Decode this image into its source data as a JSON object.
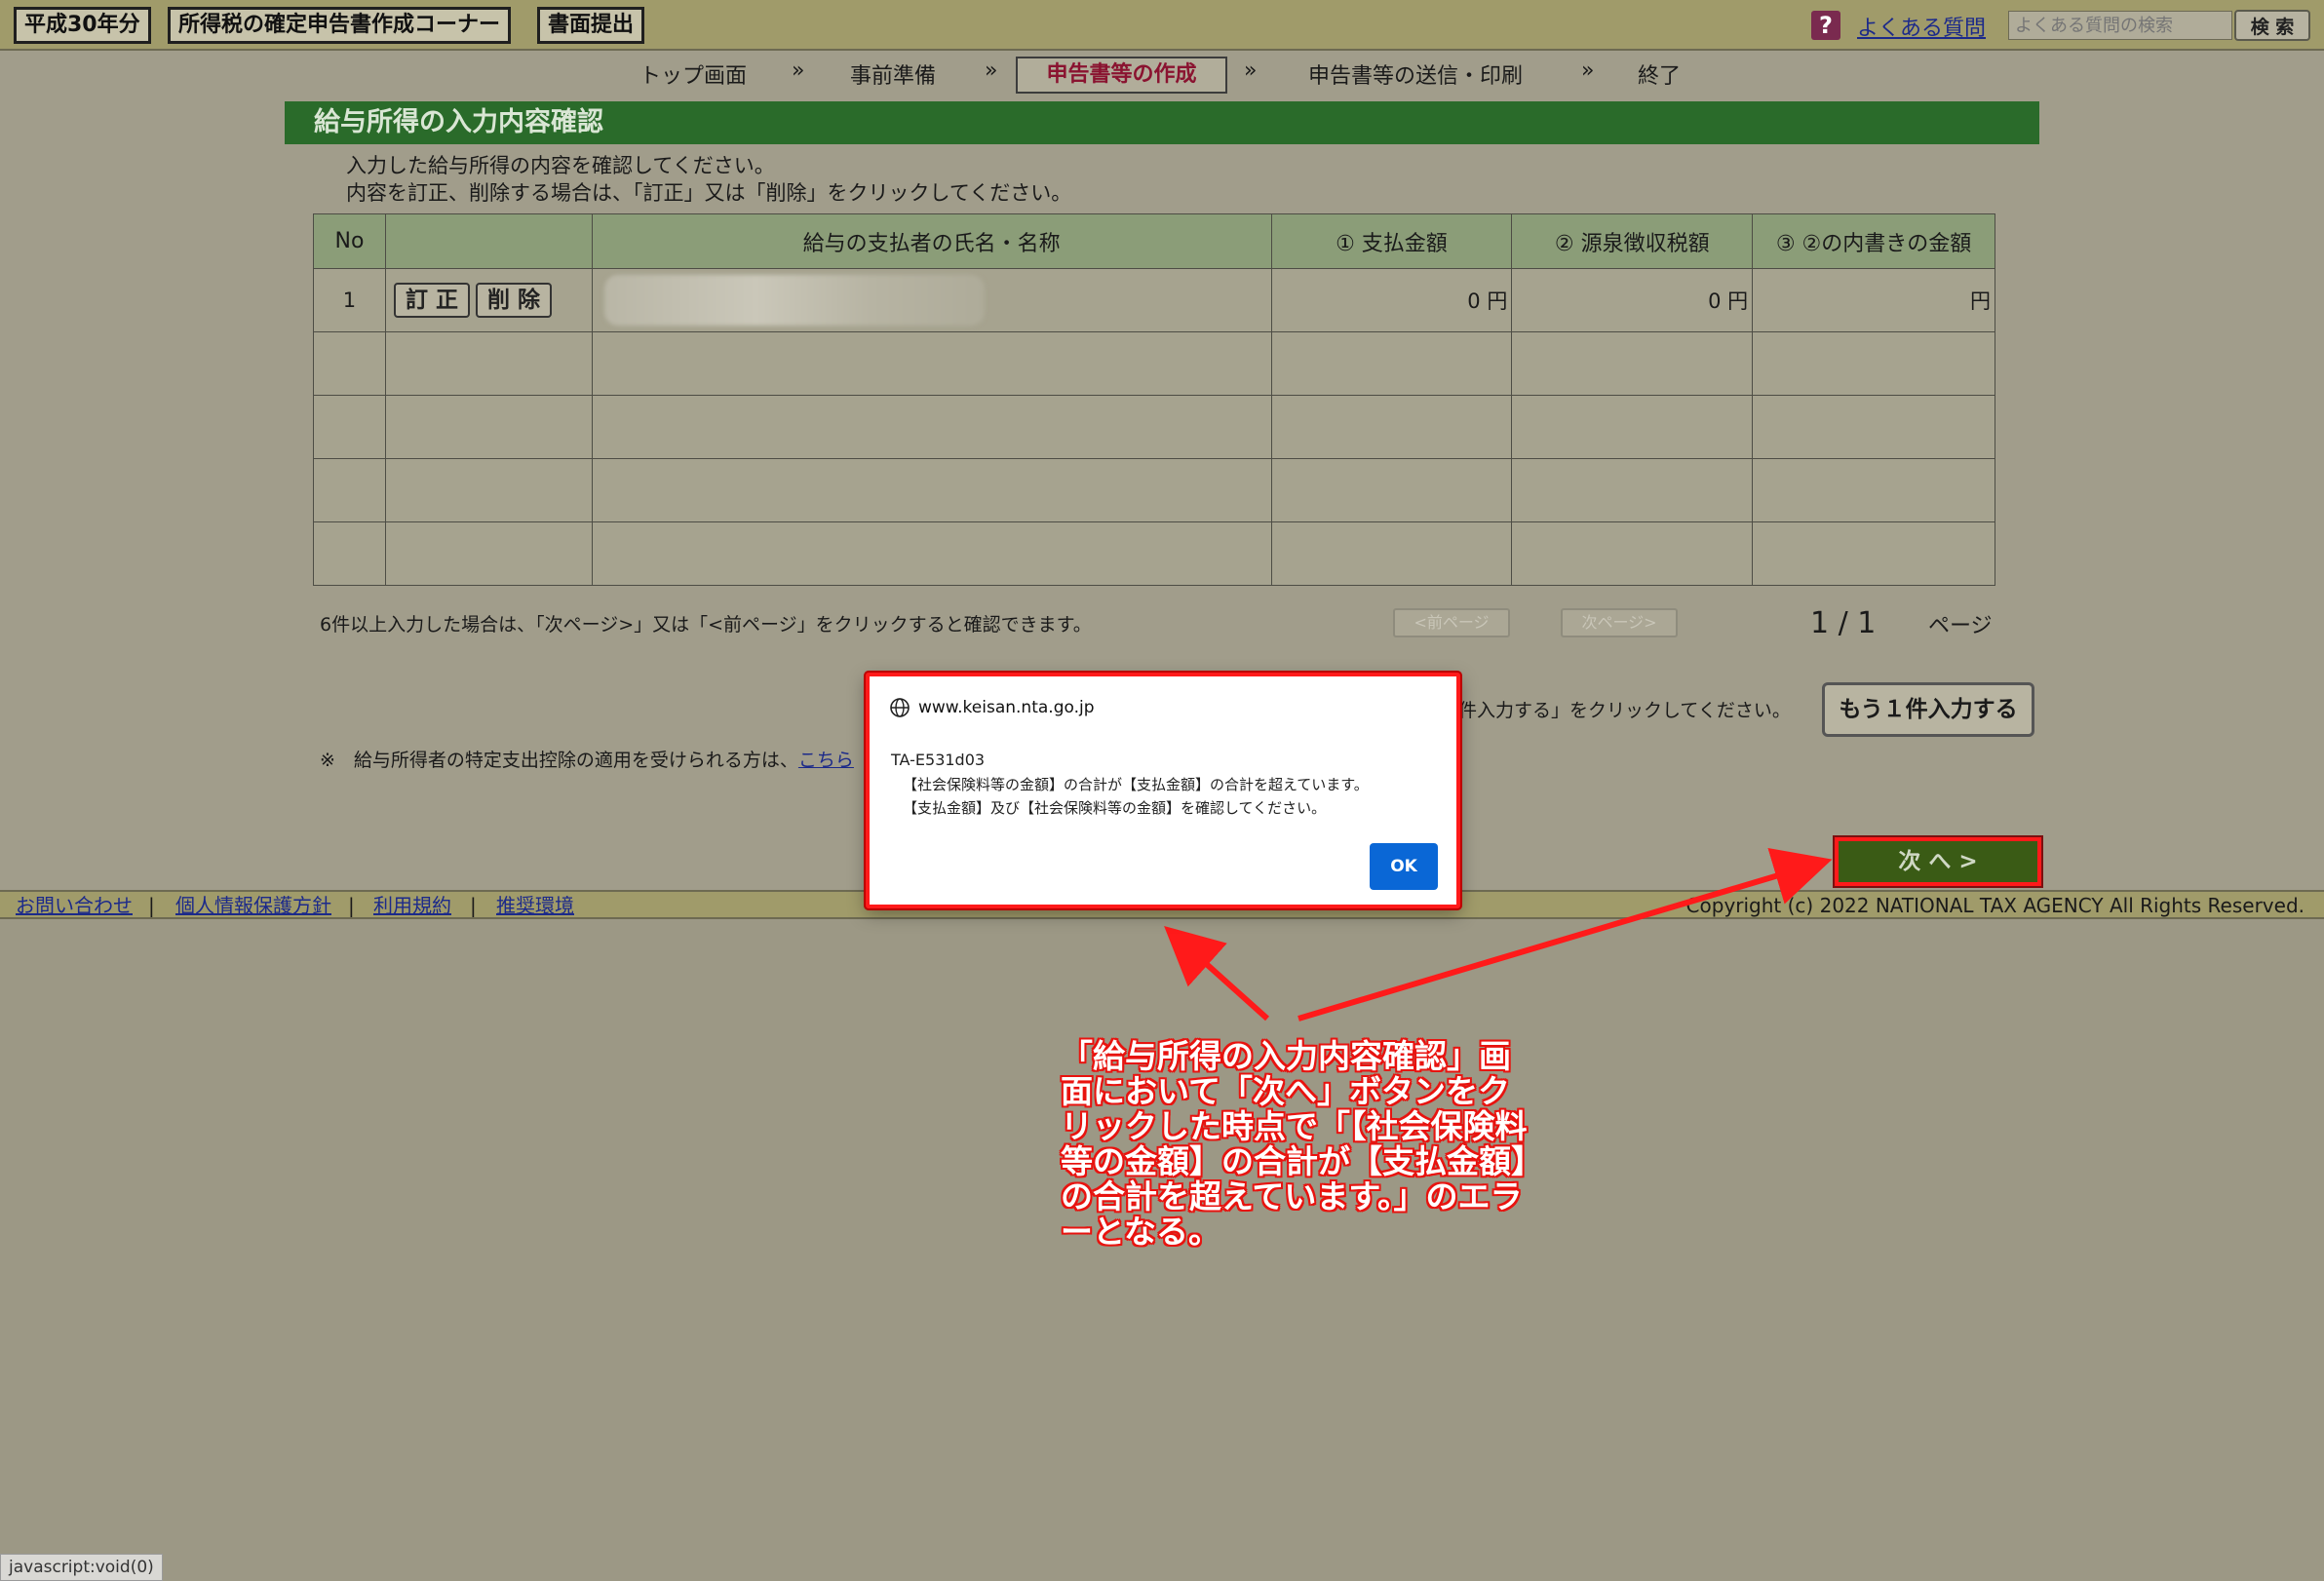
{
  "header": {
    "year_label": "平成30年分",
    "corner_label": "所得税の確定申告書作成コーナー",
    "submit_label": "書面提出",
    "faq_icon": "question-icon",
    "faq_link": "よくある質問",
    "search_placeholder": "よくある質問の検索",
    "search_button": "検 索"
  },
  "steps": {
    "items": [
      "トップ画面",
      "事前準備",
      "申告書等の作成",
      "申告書等の送信・印刷",
      "終了"
    ],
    "separator": "»",
    "active": "申告書等の作成"
  },
  "section": {
    "title": "給与所得の入力内容確認",
    "instruction_1": "入力した給与所得の内容を確認してください。",
    "instruction_2": "内容を訂正、削除する場合は、「訂正」又は「削除」をクリックしてください。"
  },
  "table": {
    "headers": [
      "No",
      "",
      "給与の支払者の氏名・名称",
      "① 支払金額",
      "② 源泉徴収税額",
      "③ ②の内書きの金額"
    ],
    "rows": [
      {
        "no": "1",
        "edit": "訂 正",
        "delete": "削 除",
        "name": "",
        "paid": "0 円",
        "withheld": "0 円",
        "inner": "円"
      }
    ]
  },
  "pager": {
    "note": "6件以上入力した場合は、「次ページ>」又は「<前ページ」をクリックすると確認できます。",
    "prev_label": "<前ページ",
    "next_label": "次ページ>",
    "count": "1 / 1",
    "unit": "ページ"
  },
  "add": {
    "note": "件入力する」をクリックしてください。",
    "button": "もう１件入力する"
  },
  "note2": {
    "text": "※　給与所得者の特定支出控除の適用を受けられる方は、",
    "link": "こちら"
  },
  "next_button": "次 へ >",
  "footer": {
    "links": [
      "お問い合わせ",
      "個人情報保護方針",
      "利用規約",
      "推奨環境"
    ],
    "separator": "|",
    "copyright": "Copyright (c) 2022 NATIONAL TAX AGENCY All Rights Reserved."
  },
  "status_bar": "javascript:void(0)",
  "dialog": {
    "origin": "www.keisan.nta.go.jp",
    "globe_icon": "globe-icon",
    "code": "TA-E531d03",
    "line_1": "【社会保険料等の金額】の合計が【支払金額】の合計を超えています。",
    "line_2": "【支払金額】及び【社会保険料等の金額】を確認してください。",
    "ok": "OK"
  },
  "annotation": {
    "text": "「給与所得の入力内容確認」画面において「次へ」ボタンをクリックした時点で「【社会保険料等の金額】の合計が【支払金額】の合計を超えています。」のエラーとなる。",
    "color": "#e8130f"
  }
}
